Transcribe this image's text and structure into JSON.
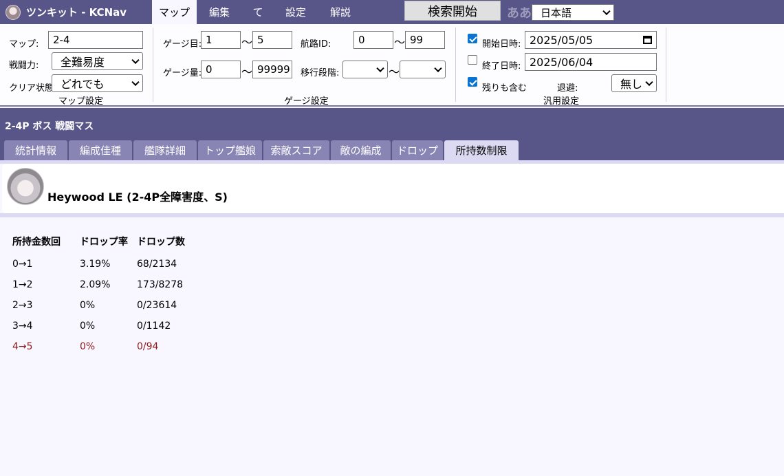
{
  "app": {
    "title": "ツンキット - KCNav",
    "logo_icon": "avatar-icon"
  },
  "nav": {
    "tabs": [
      "マップ",
      "編集",
      "て",
      "設定",
      "解説"
    ],
    "active": "マップ",
    "search_button": "検索開始",
    "font_toggle": "ああ",
    "language": "日本語"
  },
  "filters": {
    "map": {
      "map_label": "マップ:",
      "map_value": "2-4",
      "difficulty_label": "戦闘力:",
      "difficulty_value": "全難易度",
      "clear_label": "クリア状態:",
      "clear_value": "どれでも",
      "group_title": "マップ設定"
    },
    "gauge": {
      "gauge_num_label": "ゲージ目:",
      "gauge_num_from": "1",
      "gauge_num_to": "5",
      "gauge_amt_label": "ゲージ量:",
      "gauge_amt_from": "0",
      "gauge_amt_to": "99999",
      "route_label": "航路ID:",
      "route_from": "0",
      "route_to": "99",
      "phase_label": "移行段階:",
      "phase_from": "",
      "phase_to": "",
      "tilde": "〜",
      "group_title": "ゲージ設定"
    },
    "general": {
      "start_label": "開始日時:",
      "start_checked": true,
      "start_value": "2025/05/05",
      "end_label": "終了日時:",
      "end_checked": false,
      "end_value": "2025/06/04",
      "remaining_label": "残りも含む",
      "remaining_checked": true,
      "retreat_label": "退避:",
      "retreat_value": "無し",
      "group_title": "汎用設定"
    }
  },
  "section": {
    "title": "2-4P ボス 戦闘マス",
    "tabs": [
      "統計情報",
      "編成佳種",
      "艦隊詳細",
      "トップ艦娘",
      "索敵スコア",
      "敵の編成",
      "ドロップ",
      "所持数制限"
    ],
    "active_tab": "所持数制限"
  },
  "ship": {
    "name": "Heywood LE (2-4P全障害度、S)",
    "avatar_icon": "ship-portrait-icon"
  },
  "table": {
    "headers": [
      "所持金数回",
      "ドロップ率",
      "ドロップ数"
    ],
    "rows": [
      {
        "count": "0→1",
        "rate": "3.19%",
        "drops": "68/2134",
        "highlight": false
      },
      {
        "count": "1→2",
        "rate": "2.09%",
        "drops": "173/8278",
        "highlight": false
      },
      {
        "count": "2→3",
        "rate": "0%",
        "drops": "0/23614",
        "highlight": false
      },
      {
        "count": "3→4",
        "rate": "0%",
        "drops": "0/1142",
        "highlight": false
      },
      {
        "count": "4→5",
        "rate": "0%",
        "drops": "0/94",
        "highlight": true
      }
    ]
  },
  "colors": {
    "header_bg": "#585588",
    "tab_bg": "#8885b4",
    "active_tab_bg": "#dcdaf3",
    "highlight_text": "#8b1a1a",
    "checkbox": "#0b73d0"
  }
}
